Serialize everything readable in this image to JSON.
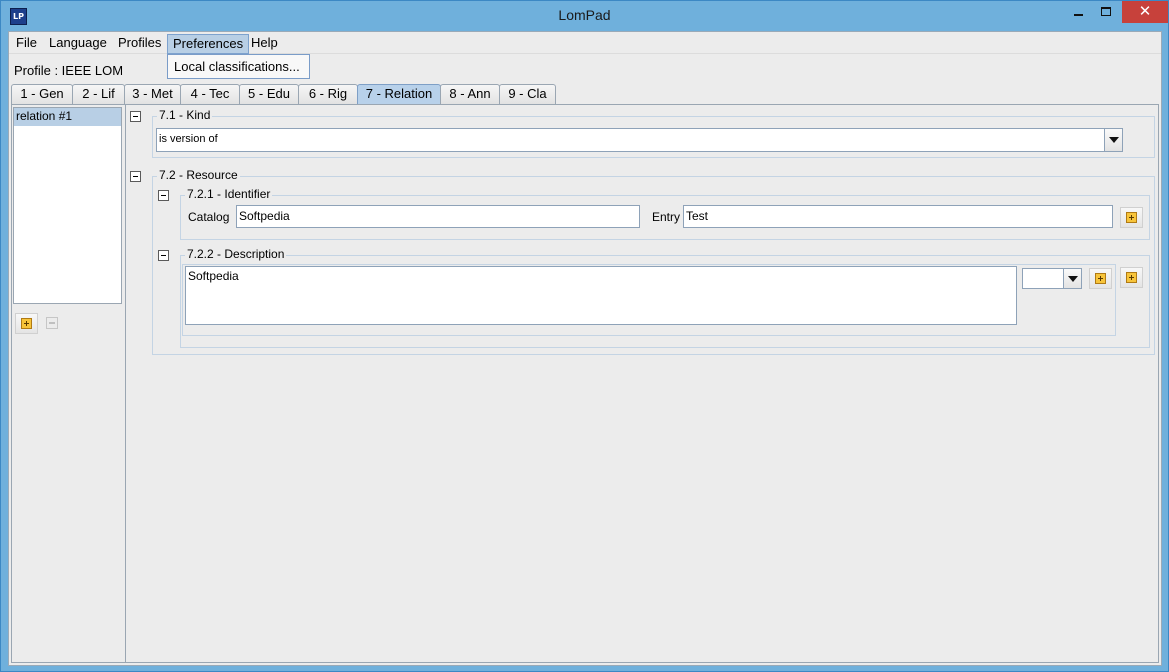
{
  "window": {
    "title": "LomPad",
    "icon": "lompad-app-icon",
    "icon_text": "LP",
    "close_glyph": "✕"
  },
  "menu": {
    "items": [
      "File",
      "Language",
      "Profiles",
      "Preferences",
      "Help"
    ],
    "active": "Preferences",
    "dropdown": [
      "Local classifications..."
    ]
  },
  "profile": {
    "label": "Profile : IEEE LOM"
  },
  "tabs": [
    "1 - Gen",
    "2 - Lif",
    "3 - Met",
    "4 - Tec",
    "5 - Edu",
    "6 - Rig",
    "7 - Relation",
    "8 - Ann",
    "9 - Cla"
  ],
  "active_tab": "7 - Relation",
  "relations_list": {
    "items": [
      "relation #1"
    ],
    "selected": "relation #1"
  },
  "kind": {
    "legend": "7.1 - Kind",
    "value": "is version of"
  },
  "resource": {
    "legend": "7.2 - Resource",
    "identifier": {
      "legend": "7.2.1 - Identifier",
      "catalog_label": "Catalog",
      "catalog_value": "Softpedia",
      "entry_label": "Entry",
      "entry_value": "Test"
    },
    "description": {
      "legend": "7.2.2 - Description",
      "value": "Softpedia",
      "language_value": ""
    }
  },
  "colors": {
    "titlebar": "#6fb0dc",
    "close_button": "#c7413b",
    "selection": "#b8cfe5",
    "active_tab": "#b8d1ea",
    "add_icon": "#f7c43a"
  }
}
